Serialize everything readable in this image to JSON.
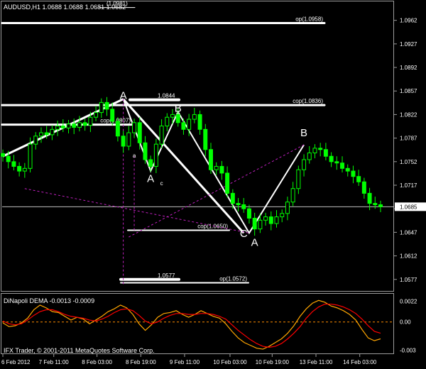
{
  "window": {
    "symbol_header": "AUDUSD,H1  1.0688 1.0688 1.0681 1.0682",
    "footer_text": "IFX Trader, © 2001-2011 MetaQuotes Software Corp."
  },
  "chart_data": [
    {
      "type": "candlestick",
      "symbol": "AUDUSD",
      "timeframe": "H1",
      "ylim": [
        1.0562,
        1.0988
      ],
      "price_ticks": [
        "1.0962",
        "1.0927",
        "1.0892",
        "1.0857",
        "1.0822",
        "1.0787",
        "1.0752",
        "1.0717",
        "1.0682",
        "1.0647",
        "1.0612",
        "1.0577"
      ],
      "current_price": "1.0685",
      "time_ticks": [
        "6 Feb 2012",
        "7 Feb 11:00",
        "8 Feb 03:00",
        "8 Feb 19:00",
        "9 Feb 11:00",
        "10 Feb 03:00",
        "10 Feb 19:00",
        "13 Feb 11:00",
        "14 Feb 03:00"
      ],
      "close_series": [
        1.076,
        1.0752,
        1.0745,
        1.0738,
        1.0742,
        1.0778,
        1.079,
        1.0795,
        1.0792,
        1.08,
        1.0805,
        1.0802,
        1.0808,
        1.0803,
        1.081,
        1.0806,
        1.0818,
        1.0825,
        1.084,
        1.083,
        1.0812,
        1.079,
        1.0775,
        1.0795,
        1.081,
        1.078,
        1.0755,
        1.0745,
        1.0778,
        1.0805,
        1.0818,
        1.0822,
        1.081,
        1.08,
        1.0815,
        1.0822,
        1.08,
        1.077,
        1.074,
        1.0745,
        1.0735,
        1.0705,
        1.069,
        1.0688,
        1.0682,
        1.0668,
        1.0652,
        1.0665,
        1.067,
        1.066,
        1.067,
        1.0675,
        1.0692,
        1.0712,
        1.074,
        1.0755,
        1.0765,
        1.0772,
        1.077,
        1.076,
        1.0752,
        1.075,
        1.0742,
        1.0738,
        1.073,
        1.0722,
        1.0705,
        1.069,
        1.0688,
        1.0685
      ],
      "horizontal_levels": [
        {
          "label": "op(1.0958)",
          "price": 1.0958
        },
        {
          "label": "cop(1.0836)",
          "price": 1.0836
        },
        {
          "label": "1.0844",
          "price": 1.0844
        },
        {
          "label": "cop(1.0807)",
          "price": 1.0807
        },
        {
          "label": "cop(1.0650)",
          "price": 1.065
        },
        {
          "label": "1.0577",
          "price": 1.0577
        },
        {
          "label": "op(1.0572)",
          "price": 1.0572
        },
        {
          "label": "(1.0981)",
          "price": 1.0981
        }
      ],
      "pattern_labels": [
        {
          "text": "A",
          "t": 22,
          "price": 1.0845
        },
        {
          "text": "B",
          "t": 32,
          "price": 1.0826
        },
        {
          "text": "a",
          "t": 24,
          "price": 1.0758
        },
        {
          "text": "A",
          "t": 27,
          "price": 1.0722
        },
        {
          "text": "c",
          "t": 29,
          "price": 1.0717
        },
        {
          "text": "C",
          "t": 44,
          "price": 1.064
        },
        {
          "text": "A",
          "t": 46,
          "price": 1.0627
        },
        {
          "text": "B",
          "t": 55,
          "price": 1.079
        }
      ]
    },
    {
      "type": "line",
      "title": "DiNapoli DEMA -0.0013 -0.0009",
      "ylim": [
        -0.0032,
        0.0027
      ],
      "y_ticks": [
        "0.0022",
        "0.00",
        "-0.003"
      ],
      "series": [
        {
          "color": "#ffa500",
          "values": [
            -0.0001,
            -0.0005,
            -0.0004,
            -0.0001,
            0.0004,
            0.0013,
            0.0018,
            0.0015,
            0.0011,
            0.001,
            0.0006,
            0.0002,
            0.0005,
            0.0003,
            -0.0002,
            0.0002,
            0.0006,
            0.0011,
            0.0014,
            0.0018,
            0.0015,
            0.0008,
            -0.0002,
            -0.0009,
            -0.0003,
            0.0005,
            0.0009,
            0.001,
            0.0012,
            0.0008,
            0.0005,
            0.0008,
            0.0012,
            0.0009,
            0.0006,
            0.0004,
            -0.0002,
            -0.001,
            -0.0017,
            -0.0022,
            -0.0025,
            -0.0028,
            -0.0029,
            -0.0026,
            -0.0022,
            -0.0018,
            -0.0012,
            -0.0004,
            0.0006,
            0.0014,
            0.002,
            0.0023,
            0.0021,
            0.0017,
            0.0015,
            0.0012,
            0.0008,
            0.0002,
            -0.0008,
            -0.0017,
            -0.002,
            -0.0018
          ]
        },
        {
          "color": "#ff0000",
          "values": [
            0.0001,
            -0.0002,
            -0.0003,
            -0.0002,
            0.0002,
            0.0007,
            0.0011,
            0.0013,
            0.0013,
            0.0011,
            0.0008,
            0.0006,
            0.0005,
            0.0004,
            0.0002,
            0.0001,
            0.0003,
            0.0006,
            0.001,
            0.0013,
            0.0014,
            0.0012,
            0.0007,
            0.0001,
            -0.0002,
            0.0,
            0.0004,
            0.0007,
            0.0009,
            0.0009,
            0.0008,
            0.0008,
            0.0009,
            0.0009,
            0.0008,
            0.0006,
            0.0003,
            -0.0003,
            -0.0009,
            -0.0014,
            -0.0019,
            -0.0023,
            -0.0026,
            -0.0027,
            -0.0026,
            -0.0023,
            -0.0018,
            -0.0012,
            -0.0005,
            0.0004,
            0.0011,
            0.0016,
            0.0019,
            0.0019,
            0.0018,
            0.0016,
            0.0013,
            0.0009,
            0.0003,
            -0.0004,
            -0.001,
            -0.0012
          ]
        }
      ]
    }
  ]
}
